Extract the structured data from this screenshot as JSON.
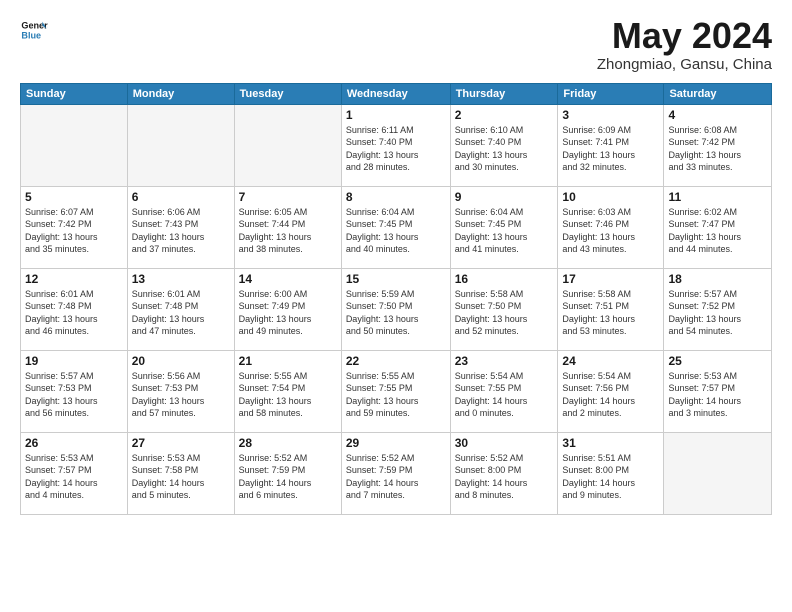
{
  "header": {
    "logo_line1": "General",
    "logo_line2": "Blue",
    "title": "May 2024",
    "subtitle": "Zhongmiao, Gansu, China"
  },
  "weekdays": [
    "Sunday",
    "Monday",
    "Tuesday",
    "Wednesday",
    "Thursday",
    "Friday",
    "Saturday"
  ],
  "weeks": [
    [
      {
        "day": "",
        "info": ""
      },
      {
        "day": "",
        "info": ""
      },
      {
        "day": "",
        "info": ""
      },
      {
        "day": "1",
        "info": "Sunrise: 6:11 AM\nSunset: 7:40 PM\nDaylight: 13 hours\nand 28 minutes."
      },
      {
        "day": "2",
        "info": "Sunrise: 6:10 AM\nSunset: 7:40 PM\nDaylight: 13 hours\nand 30 minutes."
      },
      {
        "day": "3",
        "info": "Sunrise: 6:09 AM\nSunset: 7:41 PM\nDaylight: 13 hours\nand 32 minutes."
      },
      {
        "day": "4",
        "info": "Sunrise: 6:08 AM\nSunset: 7:42 PM\nDaylight: 13 hours\nand 33 minutes."
      }
    ],
    [
      {
        "day": "5",
        "info": "Sunrise: 6:07 AM\nSunset: 7:42 PM\nDaylight: 13 hours\nand 35 minutes."
      },
      {
        "day": "6",
        "info": "Sunrise: 6:06 AM\nSunset: 7:43 PM\nDaylight: 13 hours\nand 37 minutes."
      },
      {
        "day": "7",
        "info": "Sunrise: 6:05 AM\nSunset: 7:44 PM\nDaylight: 13 hours\nand 38 minutes."
      },
      {
        "day": "8",
        "info": "Sunrise: 6:04 AM\nSunset: 7:45 PM\nDaylight: 13 hours\nand 40 minutes."
      },
      {
        "day": "9",
        "info": "Sunrise: 6:04 AM\nSunset: 7:45 PM\nDaylight: 13 hours\nand 41 minutes."
      },
      {
        "day": "10",
        "info": "Sunrise: 6:03 AM\nSunset: 7:46 PM\nDaylight: 13 hours\nand 43 minutes."
      },
      {
        "day": "11",
        "info": "Sunrise: 6:02 AM\nSunset: 7:47 PM\nDaylight: 13 hours\nand 44 minutes."
      }
    ],
    [
      {
        "day": "12",
        "info": "Sunrise: 6:01 AM\nSunset: 7:48 PM\nDaylight: 13 hours\nand 46 minutes."
      },
      {
        "day": "13",
        "info": "Sunrise: 6:01 AM\nSunset: 7:48 PM\nDaylight: 13 hours\nand 47 minutes."
      },
      {
        "day": "14",
        "info": "Sunrise: 6:00 AM\nSunset: 7:49 PM\nDaylight: 13 hours\nand 49 minutes."
      },
      {
        "day": "15",
        "info": "Sunrise: 5:59 AM\nSunset: 7:50 PM\nDaylight: 13 hours\nand 50 minutes."
      },
      {
        "day": "16",
        "info": "Sunrise: 5:58 AM\nSunset: 7:50 PM\nDaylight: 13 hours\nand 52 minutes."
      },
      {
        "day": "17",
        "info": "Sunrise: 5:58 AM\nSunset: 7:51 PM\nDaylight: 13 hours\nand 53 minutes."
      },
      {
        "day": "18",
        "info": "Sunrise: 5:57 AM\nSunset: 7:52 PM\nDaylight: 13 hours\nand 54 minutes."
      }
    ],
    [
      {
        "day": "19",
        "info": "Sunrise: 5:57 AM\nSunset: 7:53 PM\nDaylight: 13 hours\nand 56 minutes."
      },
      {
        "day": "20",
        "info": "Sunrise: 5:56 AM\nSunset: 7:53 PM\nDaylight: 13 hours\nand 57 minutes."
      },
      {
        "day": "21",
        "info": "Sunrise: 5:55 AM\nSunset: 7:54 PM\nDaylight: 13 hours\nand 58 minutes."
      },
      {
        "day": "22",
        "info": "Sunrise: 5:55 AM\nSunset: 7:55 PM\nDaylight: 13 hours\nand 59 minutes."
      },
      {
        "day": "23",
        "info": "Sunrise: 5:54 AM\nSunset: 7:55 PM\nDaylight: 14 hours\nand 0 minutes."
      },
      {
        "day": "24",
        "info": "Sunrise: 5:54 AM\nSunset: 7:56 PM\nDaylight: 14 hours\nand 2 minutes."
      },
      {
        "day": "25",
        "info": "Sunrise: 5:53 AM\nSunset: 7:57 PM\nDaylight: 14 hours\nand 3 minutes."
      }
    ],
    [
      {
        "day": "26",
        "info": "Sunrise: 5:53 AM\nSunset: 7:57 PM\nDaylight: 14 hours\nand 4 minutes."
      },
      {
        "day": "27",
        "info": "Sunrise: 5:53 AM\nSunset: 7:58 PM\nDaylight: 14 hours\nand 5 minutes."
      },
      {
        "day": "28",
        "info": "Sunrise: 5:52 AM\nSunset: 7:59 PM\nDaylight: 14 hours\nand 6 minutes."
      },
      {
        "day": "29",
        "info": "Sunrise: 5:52 AM\nSunset: 7:59 PM\nDaylight: 14 hours\nand 7 minutes."
      },
      {
        "day": "30",
        "info": "Sunrise: 5:52 AM\nSunset: 8:00 PM\nDaylight: 14 hours\nand 8 minutes."
      },
      {
        "day": "31",
        "info": "Sunrise: 5:51 AM\nSunset: 8:00 PM\nDaylight: 14 hours\nand 9 minutes."
      },
      {
        "day": "",
        "info": ""
      }
    ]
  ]
}
